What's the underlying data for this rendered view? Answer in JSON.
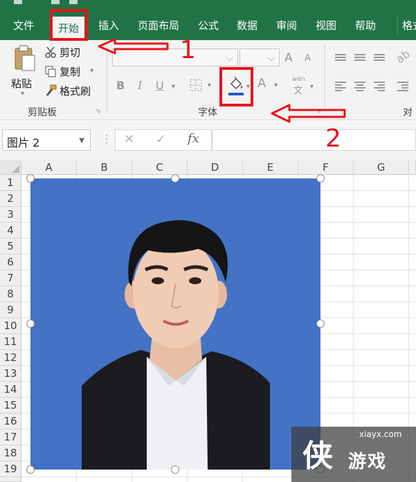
{
  "ribbon": {
    "tabs": [
      {
        "id": "file",
        "label": "文件"
      },
      {
        "id": "home",
        "label": "开始",
        "active": true
      },
      {
        "id": "insert",
        "label": "插入"
      },
      {
        "id": "page-layout",
        "label": "页面布局"
      },
      {
        "id": "formulas",
        "label": "公式"
      },
      {
        "id": "data",
        "label": "数据"
      },
      {
        "id": "review",
        "label": "审阅"
      },
      {
        "id": "view",
        "label": "视图"
      },
      {
        "id": "help",
        "label": "帮助"
      },
      {
        "id": "format",
        "label": "格式"
      }
    ],
    "clipboard": {
      "paste_label": "粘贴",
      "cut_label": "剪切",
      "copy_label": "复制",
      "format_painter_label": "格式刷",
      "group_label": "剪贴板"
    },
    "font": {
      "group_label": "字体",
      "bold": "B",
      "italic": "I",
      "underline": "U",
      "grow": "A",
      "shrink": "A",
      "font_color": "A",
      "phonetic_top": "wén",
      "phonetic_char": "文"
    },
    "alignment": {
      "group_label": "对齐"
    }
  },
  "formula_bar": {
    "name_box": "图片 2",
    "cancel": "✕",
    "enter": "✓",
    "fx": "fx"
  },
  "grid": {
    "columns": [
      "A",
      "B",
      "C",
      "D",
      "E",
      "F",
      "G"
    ],
    "rows": [
      "1",
      "2",
      "3",
      "4",
      "5",
      "6",
      "7",
      "8",
      "9",
      "10",
      "11",
      "12",
      "13",
      "14",
      "15",
      "16",
      "17",
      "18",
      "19"
    ]
  },
  "picture": {
    "name": "图片 2",
    "background": "#4472c4"
  },
  "annotations": {
    "step1": "1",
    "step2": "2",
    "color": "#e8141b"
  },
  "watermark": {
    "site": "xiayx.com",
    "logo_char": "侠",
    "text": "游戏"
  },
  "colors": {
    "accent": "#217346",
    "ribbon_bg": "#f3f3f3",
    "fill_color_bar": "#2f55c8"
  }
}
